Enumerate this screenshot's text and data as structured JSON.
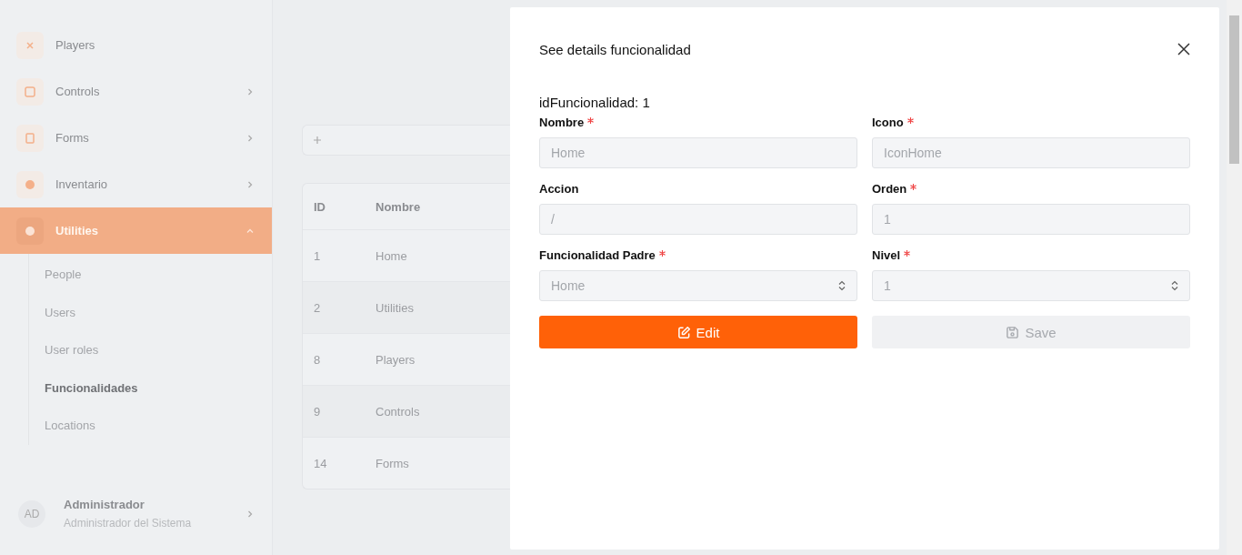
{
  "sidebar": {
    "items": [
      {
        "label": "Players",
        "expandable": false,
        "selected": false
      },
      {
        "label": "Controls",
        "expandable": true,
        "expanded": false,
        "selected": false
      },
      {
        "label": "Forms",
        "expandable": true,
        "expanded": false,
        "selected": false
      },
      {
        "label": "Inventario",
        "expandable": true,
        "expanded": false,
        "selected": false
      },
      {
        "label": "Utilities",
        "expandable": true,
        "selected": true,
        "expanded": true,
        "children": [
          {
            "label": "People",
            "selected": false
          },
          {
            "label": "Users",
            "selected": false
          },
          {
            "label": "User roles",
            "selected": false
          },
          {
            "label": "Funcionalidades",
            "selected": true
          },
          {
            "label": "Locations",
            "selected": false
          }
        ]
      }
    ],
    "user": {
      "initials": "AD",
      "name": "Administrador",
      "role": "Administrador del Sistema"
    }
  },
  "table": {
    "columns": [
      "ID",
      "Nombre"
    ],
    "rows": [
      [
        "1",
        "Home"
      ],
      [
        "2",
        "Utilities"
      ],
      [
        "8",
        "Players"
      ],
      [
        "9",
        "Controls"
      ],
      [
        "14",
        "Forms"
      ]
    ]
  },
  "modal": {
    "title": "See details funcionalidad",
    "id_line": "idFuncionalidad: 1",
    "fields": [
      {
        "label": "Nombre",
        "required": true,
        "kind": "input",
        "value": "Home"
      },
      {
        "label": "Icono",
        "required": true,
        "kind": "input",
        "value": "IconHome"
      },
      {
        "label": "Accion",
        "required": false,
        "kind": "input",
        "value": "/"
      },
      {
        "label": "Orden",
        "required": true,
        "kind": "input",
        "value": "1"
      },
      {
        "label": "Funcionalidad Padre",
        "required": true,
        "kind": "select",
        "value": "Home"
      },
      {
        "label": "Nivel",
        "required": true,
        "kind": "select",
        "value": "1"
      }
    ],
    "buttons": [
      {
        "label": "Edit",
        "kind": "edit",
        "disabled": false
      },
      {
        "label": "Save",
        "kind": "save",
        "disabled": true
      }
    ]
  }
}
